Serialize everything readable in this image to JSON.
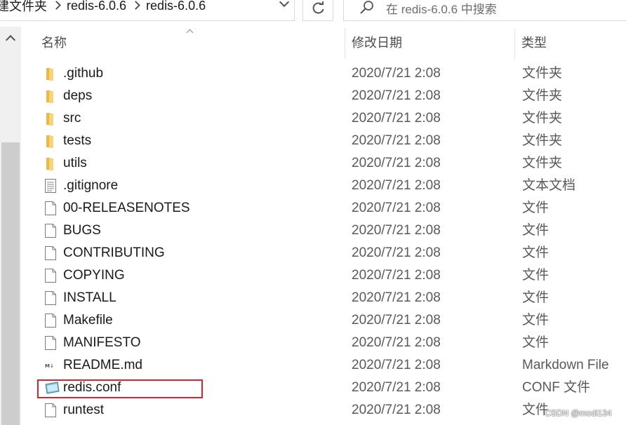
{
  "address_bar": {
    "crumbs": [
      "建文件夹",
      "redis-6.0.6",
      "redis-6.0.6"
    ]
  },
  "search": {
    "placeholder": "在 redis-6.0.6 中搜索"
  },
  "columns": {
    "name": "名称",
    "date": "修改日期",
    "type": "类型"
  },
  "files": [
    {
      "name": ".github",
      "date": "2020/7/21 2:08",
      "type": "文件夹",
      "icon": "folder-icon"
    },
    {
      "name": "deps",
      "date": "2020/7/21 2:08",
      "type": "文件夹",
      "icon": "folder-icon"
    },
    {
      "name": "src",
      "date": "2020/7/21 2:08",
      "type": "文件夹",
      "icon": "folder-icon"
    },
    {
      "name": "tests",
      "date": "2020/7/21 2:08",
      "type": "文件夹",
      "icon": "folder-icon"
    },
    {
      "name": "utils",
      "date": "2020/7/21 2:08",
      "type": "文件夹",
      "icon": "folder-icon"
    },
    {
      "name": ".gitignore",
      "date": "2020/7/21 2:08",
      "type": "文本文档",
      "icon": "text-document-icon"
    },
    {
      "name": "00-RELEASENOTES",
      "date": "2020/7/21 2:08",
      "type": "文件",
      "icon": "blank-file-icon"
    },
    {
      "name": "BUGS",
      "date": "2020/7/21 2:08",
      "type": "文件",
      "icon": "blank-file-icon"
    },
    {
      "name": "CONTRIBUTING",
      "date": "2020/7/21 2:08",
      "type": "文件",
      "icon": "blank-file-icon"
    },
    {
      "name": "COPYING",
      "date": "2020/7/21 2:08",
      "type": "文件",
      "icon": "blank-file-icon"
    },
    {
      "name": "INSTALL",
      "date": "2020/7/21 2:08",
      "type": "文件",
      "icon": "blank-file-icon"
    },
    {
      "name": "Makefile",
      "date": "2020/7/21 2:08",
      "type": "文件",
      "icon": "blank-file-icon"
    },
    {
      "name": "MANIFESTO",
      "date": "2020/7/21 2:08",
      "type": "文件",
      "icon": "blank-file-icon"
    },
    {
      "name": "README.md",
      "date": "2020/7/21 2:08",
      "type": "Markdown File",
      "icon": "markdown-file-icon"
    },
    {
      "name": "redis.conf",
      "date": "2020/7/21 2:08",
      "type": "CONF 文件",
      "icon": "conf-file-icon",
      "highlighted": true
    },
    {
      "name": "runtest",
      "date": "2020/7/21 2:08",
      "type": "文件",
      "icon": "blank-file-icon"
    }
  ],
  "watermark": "CSDN @modi134",
  "colors": {
    "highlight_border": "#d9232d",
    "folder": "#f0c75e",
    "scrollbar_thumb": "#cdcdcd"
  }
}
